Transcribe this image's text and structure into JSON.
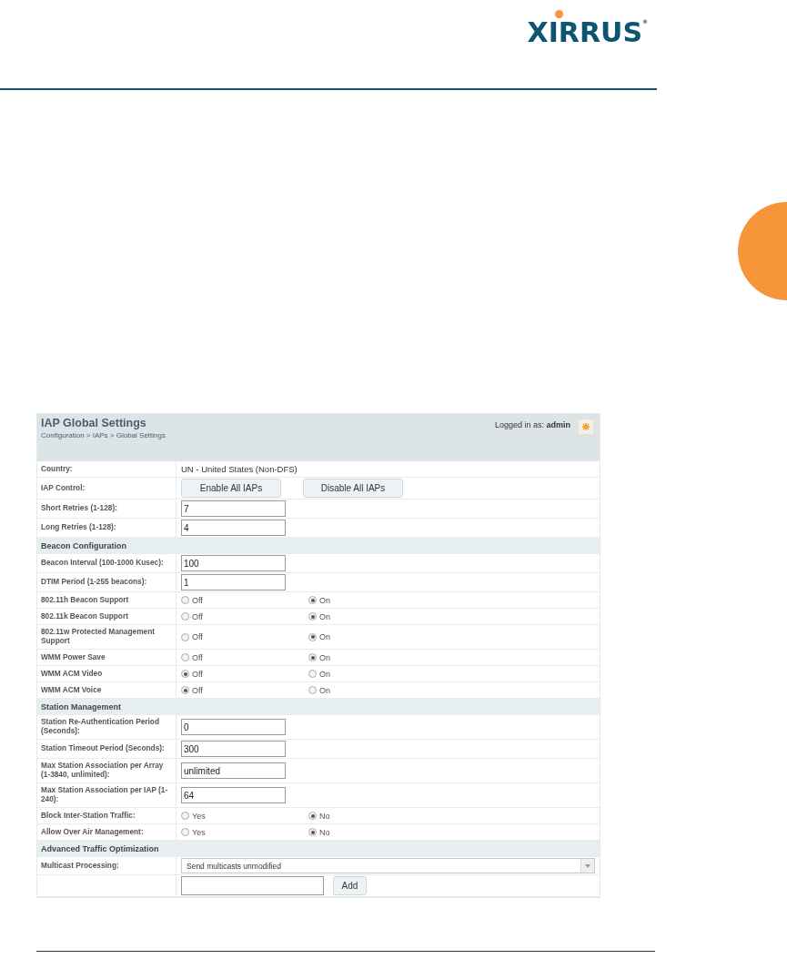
{
  "logo": {
    "text": "XIRRUS",
    "mark": "®"
  },
  "panel": {
    "title": "IAP Global Settings",
    "breadcrumb": "Configuration > IAPs > Global Settings",
    "login_label": "Logged in as:",
    "login_user": "admin"
  },
  "rows": [
    {
      "kind": "text",
      "label": "Country:",
      "value": "UN - United States (Non-DFS)"
    },
    {
      "kind": "buttons",
      "label": "IAP Control:",
      "buttons": [
        "Enable All IAPs",
        "Disable All IAPs"
      ]
    },
    {
      "kind": "input",
      "label": "Short Retries (1-128):",
      "value": "7"
    },
    {
      "kind": "input",
      "label": "Long Retries (1-128):",
      "value": "4"
    },
    {
      "kind": "section",
      "label": "Beacon Configuration"
    },
    {
      "kind": "input",
      "label": "Beacon Interval (100-1000 Kusec):",
      "value": "100"
    },
    {
      "kind": "input",
      "label": "DTIM Period (1-255 beacons):",
      "value": "1"
    },
    {
      "kind": "radio",
      "label": "802.11h Beacon Support",
      "options": [
        {
          "label": "Off",
          "selected": false
        },
        {
          "label": "On",
          "selected": true
        }
      ]
    },
    {
      "kind": "radio",
      "label": "802.11k Beacon Support",
      "options": [
        {
          "label": "Off",
          "selected": false
        },
        {
          "label": "On",
          "selected": true
        }
      ]
    },
    {
      "kind": "radio",
      "label": "802.11w Protected Management Support",
      "options": [
        {
          "label": "Off",
          "selected": false
        },
        {
          "label": "On",
          "selected": true
        }
      ]
    },
    {
      "kind": "radio",
      "label": "WMM Power Save",
      "options": [
        {
          "label": "Off",
          "selected": false
        },
        {
          "label": "On",
          "selected": true
        }
      ]
    },
    {
      "kind": "radio",
      "label": "WMM ACM Video",
      "options": [
        {
          "label": "Off",
          "selected": true
        },
        {
          "label": "On",
          "selected": false
        }
      ]
    },
    {
      "kind": "radio",
      "label": "WMM ACM Voice",
      "options": [
        {
          "label": "Off",
          "selected": true
        },
        {
          "label": "On",
          "selected": false
        }
      ]
    },
    {
      "kind": "section",
      "label": "Station Management"
    },
    {
      "kind": "input",
      "label": "Station Re-Authentication Period (Seconds):",
      "value": "0"
    },
    {
      "kind": "input",
      "label": "Station Timeout Period (Seconds):",
      "value": "300"
    },
    {
      "kind": "input",
      "label": "Max Station Association per Array (1-3840, unlimited):",
      "value": "unlimited"
    },
    {
      "kind": "input",
      "label": "Max Station Association per IAP (1-240):",
      "value": "64"
    },
    {
      "kind": "radio",
      "label": "Block Inter-Station Traffic:",
      "options": [
        {
          "label": "Yes",
          "selected": false
        },
        {
          "label": "No",
          "selected": true
        }
      ]
    },
    {
      "kind": "radio",
      "label": "Allow Over Air Management:",
      "options": [
        {
          "label": "Yes",
          "selected": false
        },
        {
          "label": "No",
          "selected": true
        }
      ]
    },
    {
      "kind": "section",
      "label": "Advanced Traffic Optimization"
    },
    {
      "kind": "select",
      "label": "Multicast Processing:",
      "value": "Send multicasts unmodified"
    },
    {
      "kind": "add",
      "button": "Add"
    }
  ]
}
